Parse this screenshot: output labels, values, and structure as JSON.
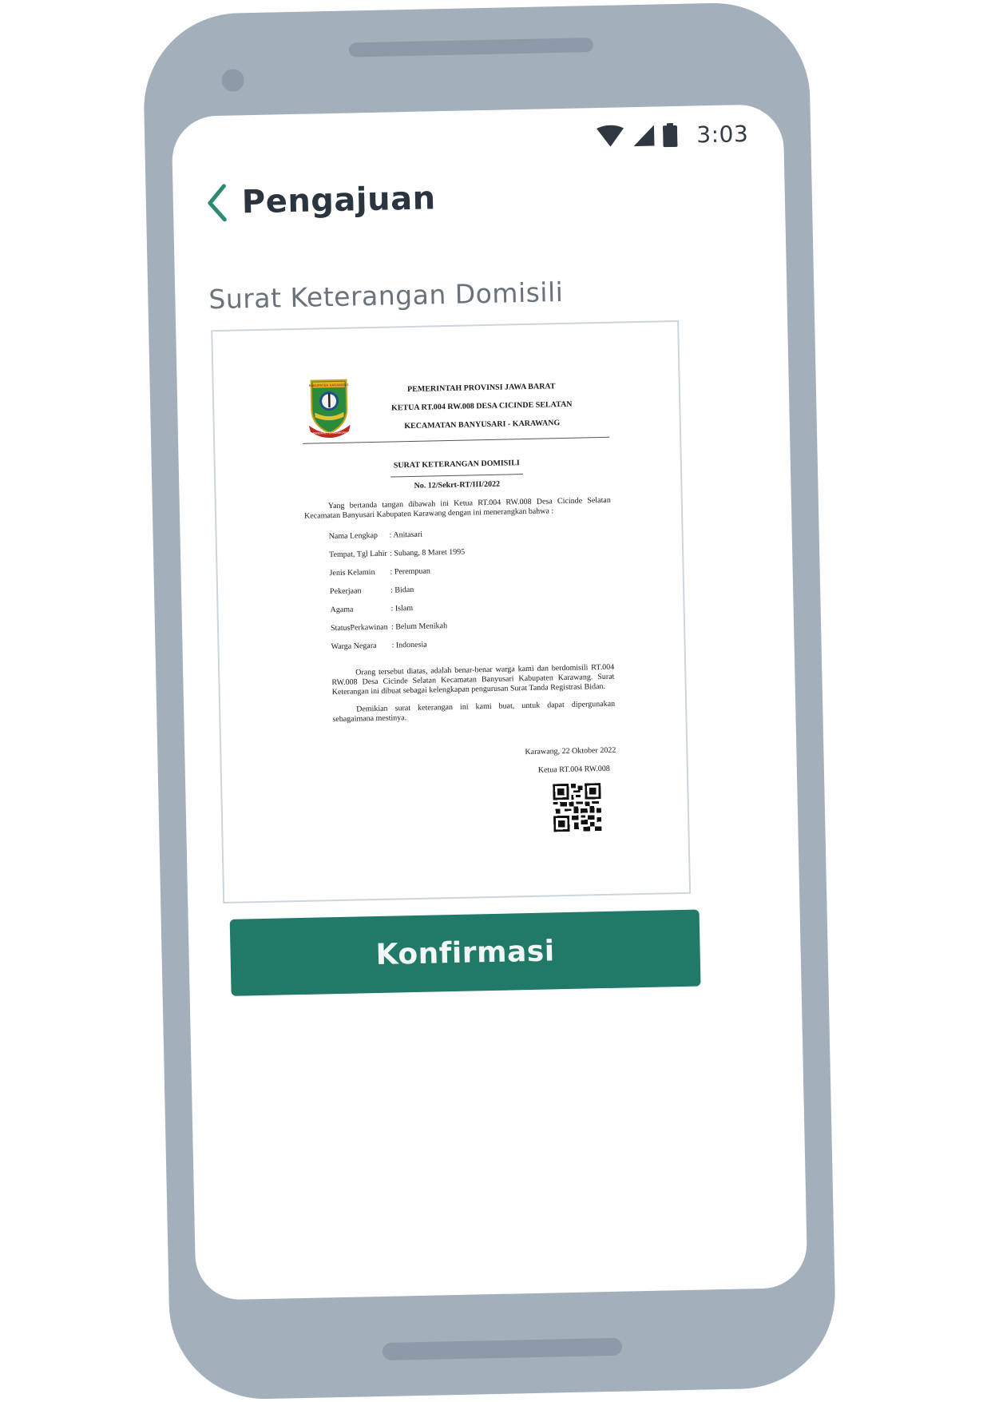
{
  "status_bar": {
    "time": "3:03",
    "icons": [
      "wifi-icon",
      "signal-icon",
      "battery-icon"
    ]
  },
  "header": {
    "back_icon": "chevron-left-icon",
    "title": "Pengajuan"
  },
  "document": {
    "title": "Surat Keterangan Domisili",
    "letter": {
      "logo_text_top": "KABUPATEN KARAWANG",
      "logo_text_bottom": "PANGKAL PERJUANGAN",
      "kop": [
        "PEMERINTAH PROVINSI JAWA BARAT",
        "KETUA RT.004 RW.008 DESA CICINDE SELATAN",
        "KECAMATAN BANYUSARI - KARAWANG"
      ],
      "judul": "SURAT KETERANGAN DOMISILI",
      "nomor": "No. 12/Sekrt-RT/III/2022",
      "pembuka": "Yang bertanda tangan dibawah ini Ketua RT.004 RW.008 Desa Cicinde Selatan Kecamatan Banyusari Kabupaten Karawang dengan ini menerangkan bahwa :",
      "fields": [
        {
          "label": "Nama Lengkap",
          "value": ": Anitasari"
        },
        {
          "label": "Tempat, Tgl Lahir",
          "value": ": Subang, 8 Maret 1995"
        },
        {
          "label": "Jenis Kelamin",
          "value": ": Perempuan"
        },
        {
          "label": "Pekerjaan",
          "value": ": Bidan"
        },
        {
          "label": "Agama",
          "value": ": Islam"
        },
        {
          "label": "StatusPerkawinan",
          "value": ": Belum Menikah"
        },
        {
          "label": "Warga Negara",
          "value": ": Indonesia"
        }
      ],
      "isi": "Orang tersebut diatas, adalah benar-benar warga kami dan berdomisili RT.004 RW.008 Desa Cicinde Selatan Kecamatan Banyusari Kabupaten Karawang. Surat Keterangan ini dibuat sebagai kelengkapan pengurusan Surat Tanda Registrasi Bidan.",
      "penutup": "Demikian surat keterangan ini kami buat, untuk dapat dipergunakan sebagaimana mestinya.",
      "tempat_tanggal": "Karawang, 22 Oktober 2022",
      "jabatan": "Ketua RT.004 RW.008",
      "signature_icon": "qr-code-icon"
    }
  },
  "actions": {
    "confirm_label": "Konfirmasi"
  },
  "colors": {
    "phone_frame": "#a3afbb",
    "primary": "#217a68",
    "back_arrow": "#2e8a72",
    "title_text": "#2a3540"
  }
}
